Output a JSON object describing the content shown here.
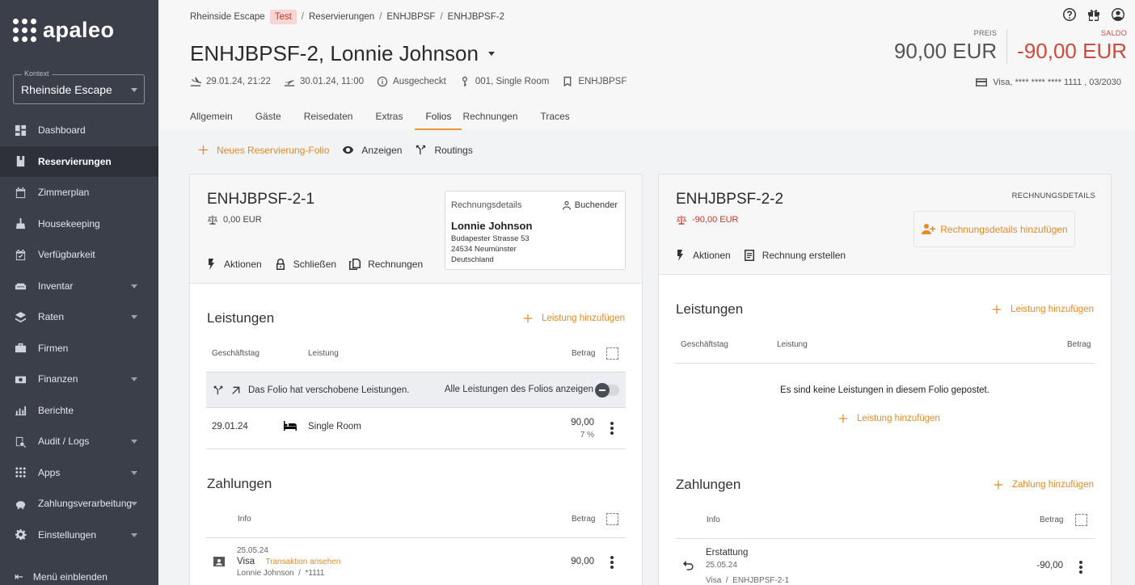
{
  "sidebar": {
    "logo": "apaleo",
    "context_label": "Kontext",
    "context_value": "Rheinside Escape",
    "items": [
      {
        "label": "Dashboard",
        "icon": "dashboard-icon"
      },
      {
        "label": "Reservierungen",
        "icon": "book-icon"
      },
      {
        "label": "Zimmerplan",
        "icon": "calendar-icon"
      },
      {
        "label": "Housekeeping",
        "icon": "broom-icon"
      },
      {
        "label": "Verfügbarkeit",
        "icon": "calendar-check-icon"
      },
      {
        "label": "Inventar",
        "icon": "sofa-icon"
      },
      {
        "label": "Raten",
        "icon": "layers-icon"
      },
      {
        "label": "Firmen",
        "icon": "briefcase-icon"
      },
      {
        "label": "Finanzen",
        "icon": "money-icon"
      },
      {
        "label": "Berichte",
        "icon": "chart-icon"
      },
      {
        "label": "Audit / Logs",
        "icon": "audit-icon"
      },
      {
        "label": "Apps",
        "icon": "apps-icon"
      },
      {
        "label": "Zahlungsverarbeitung",
        "icon": "piggy-bank-icon"
      },
      {
        "label": "Einstellungen",
        "icon": "gear-icon"
      }
    ],
    "toggle_label": "Menü einblenden"
  },
  "header": {
    "breadcrumb": [
      "Rheinside Escape",
      "Test",
      "Reservierungen",
      "ENHJBPSF",
      "ENHJBPSF-2"
    ],
    "title": "ENHJBPSF-2, Lonnie Johnson",
    "arrival": "29.01.24, 21:22",
    "departure": "30.01.24, 11:00",
    "status": "Ausgecheckt",
    "unit": "001, Single Room",
    "booking": "ENHJBPSF",
    "price_label": "PREIS",
    "price": "90,00 EUR",
    "saldo_label": "SALDO",
    "saldo": "-90,00 EUR",
    "card": "Visa, **** **** **** 1111 , 03/2030",
    "tabs": [
      "Allgemein",
      "Gäste",
      "Reisedaten",
      "Extras",
      "Folios",
      "Rechnungen",
      "Traces"
    ]
  },
  "toolbar": {
    "new_folio": "Neues Reservierung-Folio",
    "show": "Anzeigen",
    "routings": "Routings"
  },
  "folio1": {
    "title": "ENHJBPSF-2-1",
    "balance": "0,00 EUR",
    "actions": [
      "Aktionen",
      "Schließen",
      "Rechnungen"
    ],
    "details_title": "Rechnungsdetails",
    "details_booker": "Buchender",
    "details_name": "Lonnie Johnson",
    "details_address": [
      "Budapester Strasse 53",
      "24534 Neumünster",
      "Deutschland"
    ],
    "services_title": "Leistungen",
    "add_service": "Leistung hinzufügen",
    "col_date": "Geschäftstag",
    "col_service": "Leistung",
    "col_amount": "Betrag",
    "shifted_msg": "Das Folio hat verschobene Leistungen.",
    "show_all": "Alle Leistungen des Folios anzeigen",
    "service_row": {
      "date": "29.01.24",
      "name": "Single Room",
      "amount": "90,00",
      "vat": "7 %"
    },
    "payments_title": "Zahlungen",
    "col_info": "Info",
    "payment_row": {
      "date": "25.05.24",
      "method": "Visa",
      "link": "Transaktion ansehen",
      "sub": "Lonnie Johnson  /  *1111",
      "amount": "90,00"
    }
  },
  "folio2": {
    "title": "ENHJBPSF-2-2",
    "balance": "-90,00 EUR",
    "details_label": "RECHNUNGSDETAILS",
    "add_details": "Rechnungsdetails hinzufügen",
    "actions": [
      "Aktionen",
      "Rechnung erstellen"
    ],
    "services_title": "Leistungen",
    "add_service": "Leistung hinzufügen",
    "col_date": "Geschäftstag",
    "col_service": "Leistung",
    "col_amount": "Betrag",
    "empty_msg": "Es sind keine Leistungen in diesem Folio gepostet.",
    "payments_title": "Zahlungen",
    "add_payment": "Zahlung hinzufügen",
    "col_info": "Info",
    "payment_row": {
      "type": "Erstattung",
      "date": "25.05.24",
      "sub": "Visa  /  ENHJBPSF-2-1",
      "amount": "-90,00"
    }
  },
  "colors": {
    "accent": "#e48a26",
    "negative": "#c0392b",
    "sidebar": "#3b3f4a"
  }
}
